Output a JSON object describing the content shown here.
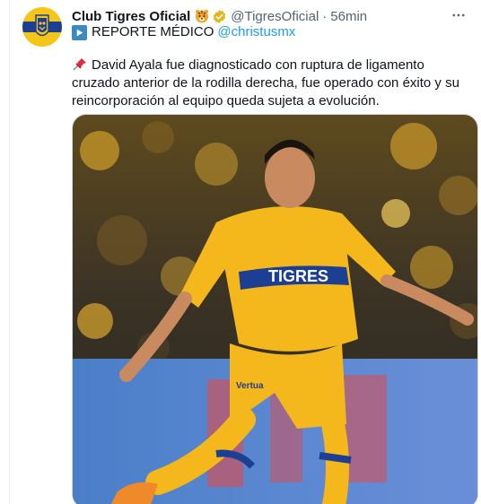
{
  "tweet": {
    "display_name": "Club Tigres Oficial",
    "handle": "@TigresOficial",
    "separator": "·",
    "time": "56min",
    "report_label": "REPORTE MÉDICO",
    "mention": "@christusmx",
    "body": "David Ayala fue diagnosticado con ruptura de ligamento cruzado anterior de la rodilla derecha, fue operado con éxito y su reincorporación al equipo queda sujeta a evolución.",
    "media": {
      "jersey_text": "TIGRES",
      "sleeve_text": "Vertua"
    }
  },
  "icons": {
    "avatar": "tigres-crest-icon",
    "emoji": "tiger-face-icon",
    "verified": "verified-badge-icon",
    "more": "more-horizontal-icon",
    "report": "play-button-icon",
    "pin": "pushpin-icon"
  },
  "colors": {
    "accent": "#1d9bf0",
    "verified_gold": "#e2b719",
    "secondary_text": "#536471",
    "tigres_yellow": "#f5b81c",
    "tigres_blue": "#1c3f94"
  }
}
